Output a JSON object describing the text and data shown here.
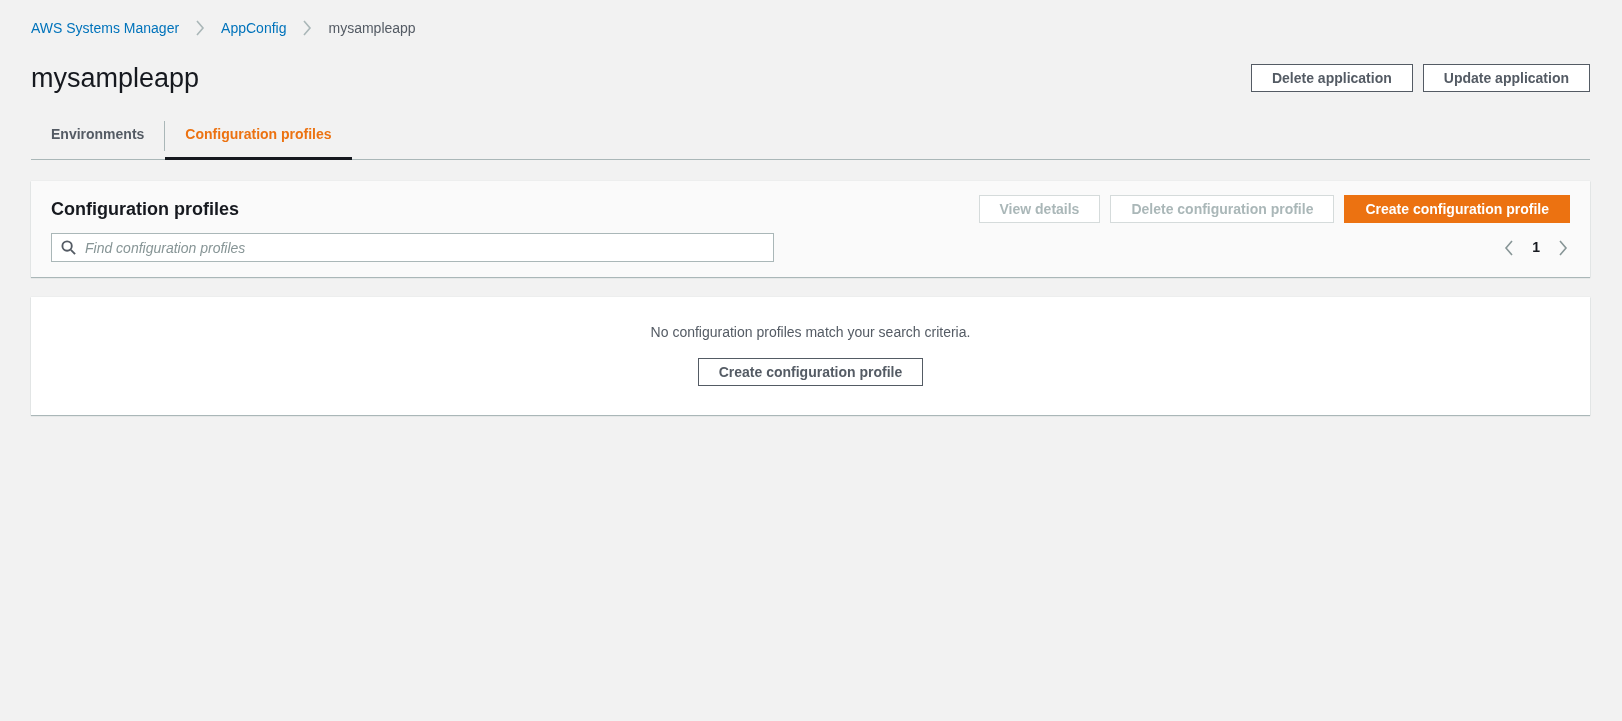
{
  "breadcrumbs": [
    {
      "label": "AWS Systems Manager",
      "link": true
    },
    {
      "label": "AppConfig",
      "link": true
    },
    {
      "label": "mysampleapp",
      "link": false
    }
  ],
  "title": "mysampleapp",
  "header_buttons": [
    {
      "label": "Delete application",
      "kind": "normal",
      "disabled": false
    },
    {
      "label": "Update application",
      "kind": "normal",
      "disabled": false
    }
  ],
  "tabs": [
    {
      "label": "Environments",
      "selected": false
    },
    {
      "label": "Configuration profiles",
      "selected": true
    }
  ],
  "table": {
    "title": "Configuration profiles",
    "buttons": [
      {
        "label": "View details",
        "kind": "normal",
        "disabled": true
      },
      {
        "label": "Delete configuration profile",
        "kind": "normal",
        "disabled": true
      },
      {
        "label": "Create configuration profile",
        "kind": "primary",
        "disabled": false
      }
    ],
    "search": {
      "placeholder": "Find configuration profiles"
    },
    "pagination": {
      "page": "1"
    },
    "empty_message": "No configuration profiles match your search criteria.",
    "empty_button": {
      "label": "Create configuration profile",
      "kind": "normal",
      "disabled": false
    }
  }
}
